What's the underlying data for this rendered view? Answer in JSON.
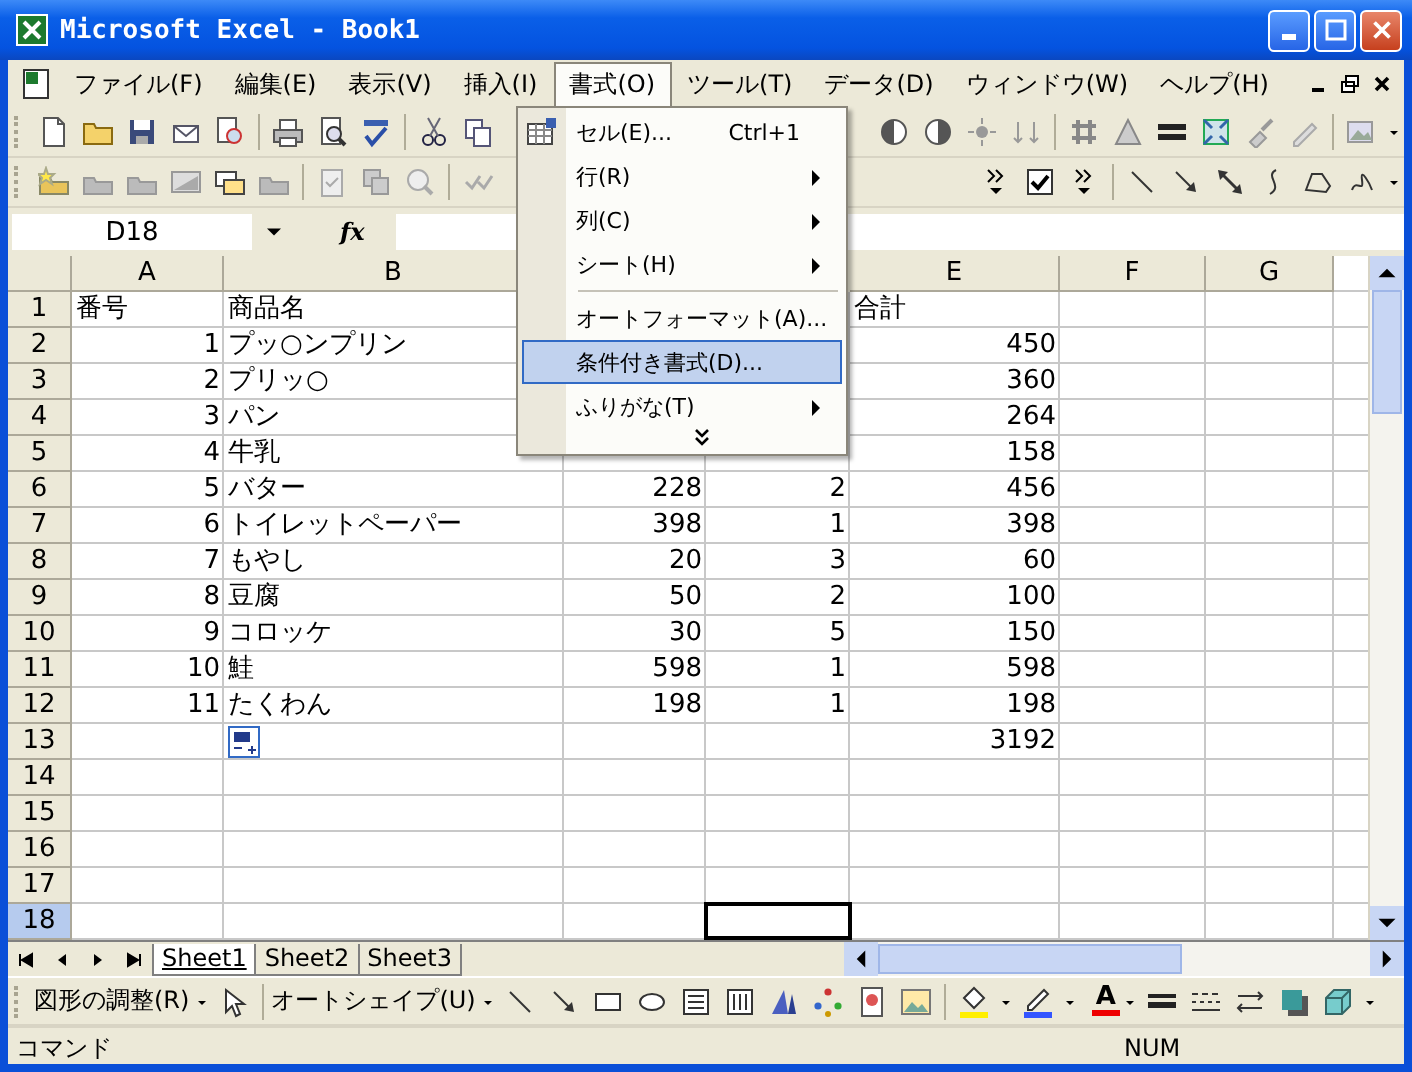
{
  "window": {
    "title": "Microsoft Excel - Book1"
  },
  "menu_bar": {
    "items": [
      {
        "label": "ファイル(F)",
        "selected": false
      },
      {
        "label": "編集(E)",
        "selected": false
      },
      {
        "label": "表示(V)",
        "selected": false
      },
      {
        "label": "挿入(I)",
        "selected": false
      },
      {
        "label": "書式(O)",
        "selected": true
      },
      {
        "label": "ツール(T)",
        "selected": false
      },
      {
        "label": "データ(D)",
        "selected": false
      },
      {
        "label": "ウィンドウ(W)",
        "selected": false
      },
      {
        "label": "ヘルプ(H)",
        "selected": false
      }
    ]
  },
  "format_menu": {
    "items": [
      {
        "kind": "command",
        "label": "セル(E)...",
        "shortcut": "Ctrl+1",
        "selected": false
      },
      {
        "kind": "submenu",
        "label": "行(R)",
        "selected": false
      },
      {
        "kind": "submenu",
        "label": "列(C)",
        "selected": false
      },
      {
        "kind": "submenu",
        "label": "シート(H)",
        "selected": false
      },
      {
        "kind": "separator"
      },
      {
        "kind": "command",
        "label": "オートフォーマット(A)...",
        "selected": false
      },
      {
        "kind": "command",
        "label": "条件付き書式(D)...",
        "selected": true
      },
      {
        "kind": "submenu",
        "label": "ふりがな(T)",
        "selected": false
      },
      {
        "kind": "expand"
      }
    ]
  },
  "formula_bar": {
    "name_box": "D18",
    "function_label": "fx"
  },
  "grid": {
    "columns": [
      "A",
      "B",
      null,
      null,
      "E",
      "F",
      "G"
    ],
    "rows": [
      {
        "label": "1",
        "kind": "header",
        "selected": false,
        "cells": [
          "番号",
          "商品名",
          null,
          null,
          "合計"
        ]
      },
      {
        "label": "2",
        "kind": "data",
        "selected": false,
        "cells": [
          "1",
          "プッ○ンプリン",
          null,
          null,
          "450"
        ]
      },
      {
        "label": "3",
        "kind": "data",
        "selected": false,
        "cells": [
          "2",
          "プリッ○",
          null,
          null,
          "360"
        ]
      },
      {
        "label": "4",
        "kind": "data",
        "selected": false,
        "cells": [
          "3",
          "パン",
          null,
          null,
          "264"
        ]
      },
      {
        "label": "5",
        "kind": "data",
        "selected": false,
        "cells": [
          "4",
          "牛乳",
          null,
          null,
          "158"
        ]
      },
      {
        "label": "6",
        "kind": "data",
        "selected": false,
        "cells": [
          "5",
          "バター",
          "228",
          "2",
          "456"
        ]
      },
      {
        "label": "7",
        "kind": "data",
        "selected": false,
        "cells": [
          "6",
          "トイレットペーパー",
          "398",
          "1",
          "398"
        ]
      },
      {
        "label": "8",
        "kind": "data",
        "selected": false,
        "cells": [
          "7",
          "もやし",
          "20",
          "3",
          "60"
        ]
      },
      {
        "label": "9",
        "kind": "data",
        "selected": false,
        "cells": [
          "8",
          "豆腐",
          "50",
          "2",
          "100"
        ]
      },
      {
        "label": "10",
        "kind": "data",
        "selected": false,
        "cells": [
          "9",
          "コロッケ",
          "30",
          "5",
          "150"
        ]
      },
      {
        "label": "11",
        "kind": "data",
        "selected": false,
        "cells": [
          "10",
          "鮭",
          "598",
          "1",
          "598"
        ]
      },
      {
        "label": "12",
        "kind": "data",
        "selected": false,
        "cells": [
          "11",
          "たくわん",
          "198",
          "1",
          "198"
        ]
      },
      {
        "label": "13",
        "kind": "data",
        "selected": false,
        "paste_options": true,
        "cells": [
          null,
          null,
          null,
          null,
          "3192"
        ]
      },
      {
        "label": "14",
        "selected": false,
        "cells": []
      },
      {
        "label": "15",
        "selected": false,
        "cells": []
      },
      {
        "label": "16",
        "selected": false,
        "cells": []
      },
      {
        "label": "17",
        "selected": false,
        "cells": []
      },
      {
        "label": "18",
        "selected": true,
        "cells": [
          null,
          null,
          null,
          {
            "selected": true
          }
        ]
      }
    ]
  },
  "sheet_tabs": [
    {
      "label": "Sheet1",
      "selected": true
    },
    {
      "label": "Sheet2",
      "selected": false
    },
    {
      "label": "Sheet3",
      "selected": false
    }
  ],
  "drawing_toolbar": {
    "draw_menu": "図形の調整(R)",
    "autoshapes_menu": "オートシェイプ(U)",
    "font_color_glyph": "A"
  },
  "status_bar": {
    "message": "コマンド",
    "indicator": "NUM"
  }
}
